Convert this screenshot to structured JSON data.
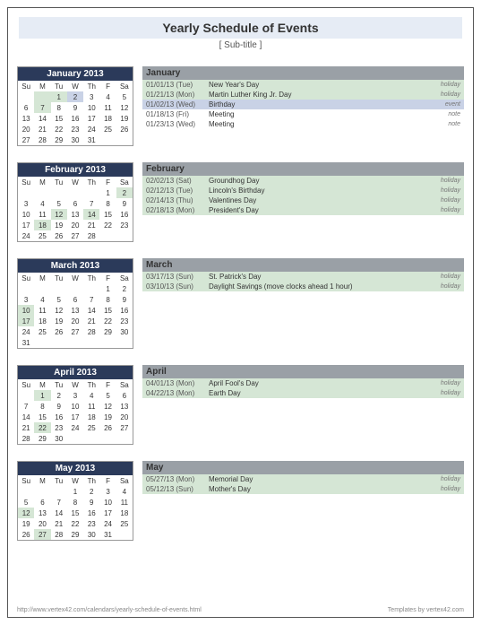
{
  "title": "Yearly Schedule of Events",
  "subtitle": "[ Sub-title ]",
  "dow": [
    "Su",
    "M",
    "Tu",
    "W",
    "Th",
    "F",
    "Sa"
  ],
  "footer_left": "http://www.vertex42.com/calendars/yearly-schedule-of-events.html",
  "footer_right": "Templates by vertex42.com",
  "months": [
    {
      "name": "January 2013",
      "short": "January",
      "weeks": [
        [
          "",
          "",
          "1",
          "2",
          "3",
          "4",
          "5"
        ],
        [
          "6",
          "7",
          "8",
          "9",
          "10",
          "11",
          "12"
        ],
        [
          "13",
          "14",
          "15",
          "16",
          "17",
          "18",
          "19"
        ],
        [
          "20",
          "21",
          "22",
          "23",
          "24",
          "25",
          "26"
        ],
        [
          "27",
          "28",
          "29",
          "30",
          "31",
          "",
          ""
        ]
      ],
      "highlights": {
        "hl": [
          [
            0,
            1
          ],
          [
            0,
            2
          ],
          [
            1,
            1
          ]
        ],
        "hl2": [
          [
            0,
            3
          ]
        ]
      },
      "events": [
        {
          "date": "01/01/13 (Tue)",
          "desc": "New Year's Day",
          "type": "holiday",
          "cls": "holiday"
        },
        {
          "date": "01/21/13 (Mon)",
          "desc": "Martin Luther King Jr. Day",
          "type": "holiday",
          "cls": "holiday"
        },
        {
          "date": "01/02/13 (Wed)",
          "desc": "Birthday",
          "type": "event",
          "cls": "event"
        },
        {
          "date": "01/18/13 (Fri)",
          "desc": "Meeting",
          "type": "note",
          "cls": "note"
        },
        {
          "date": "01/23/13 (Wed)",
          "desc": "Meeting",
          "type": "note",
          "cls": "note"
        }
      ]
    },
    {
      "name": "February 2013",
      "short": "February",
      "weeks": [
        [
          "",
          "",
          "",
          "",
          "",
          "1",
          "2"
        ],
        [
          "3",
          "4",
          "5",
          "6",
          "7",
          "8",
          "9"
        ],
        [
          "10",
          "11",
          "12",
          "13",
          "14",
          "15",
          "16"
        ],
        [
          "17",
          "18",
          "19",
          "20",
          "21",
          "22",
          "23"
        ],
        [
          "24",
          "25",
          "26",
          "27",
          "28",
          "",
          ""
        ]
      ],
      "highlights": {
        "hl": [
          [
            0,
            6
          ],
          [
            2,
            2
          ],
          [
            2,
            4
          ],
          [
            3,
            1
          ]
        ],
        "hl2": []
      },
      "events": [
        {
          "date": "02/02/13 (Sat)",
          "desc": "Groundhog Day",
          "type": "holiday",
          "cls": "holiday"
        },
        {
          "date": "02/12/13 (Tue)",
          "desc": "Lincoln's Birthday",
          "type": "holiday",
          "cls": "holiday"
        },
        {
          "date": "02/14/13 (Thu)",
          "desc": "Valentines Day",
          "type": "holiday",
          "cls": "holiday"
        },
        {
          "date": "02/18/13 (Mon)",
          "desc": "President's Day",
          "type": "holiday",
          "cls": "holiday"
        }
      ]
    },
    {
      "name": "March 2013",
      "short": "March",
      "weeks": [
        [
          "",
          "",
          "",
          "",
          "",
          "1",
          "2"
        ],
        [
          "3",
          "4",
          "5",
          "6",
          "7",
          "8",
          "9"
        ],
        [
          "10",
          "11",
          "12",
          "13",
          "14",
          "15",
          "16"
        ],
        [
          "17",
          "18",
          "19",
          "20",
          "21",
          "22",
          "23"
        ],
        [
          "24",
          "25",
          "26",
          "27",
          "28",
          "29",
          "30"
        ],
        [
          "31",
          "",
          "",
          "",
          "",
          "",
          ""
        ]
      ],
      "highlights": {
        "hl": [
          [
            2,
            0
          ],
          [
            3,
            0
          ]
        ],
        "hl2": []
      },
      "events": [
        {
          "date": "03/17/13 (Sun)",
          "desc": "St. Patrick's Day",
          "type": "holiday",
          "cls": "holiday"
        },
        {
          "date": "03/10/13 (Sun)",
          "desc": "Daylight Savings (move clocks ahead 1 hour)",
          "type": "holiday",
          "cls": "holiday"
        }
      ]
    },
    {
      "name": "April 2013",
      "short": "April",
      "weeks": [
        [
          "",
          "1",
          "2",
          "3",
          "4",
          "5",
          "6"
        ],
        [
          "7",
          "8",
          "9",
          "10",
          "11",
          "12",
          "13"
        ],
        [
          "14",
          "15",
          "16",
          "17",
          "18",
          "19",
          "20"
        ],
        [
          "21",
          "22",
          "23",
          "24",
          "25",
          "26",
          "27"
        ],
        [
          "28",
          "29",
          "30",
          "",
          "",
          "",
          ""
        ]
      ],
      "highlights": {
        "hl": [
          [
            0,
            1
          ],
          [
            3,
            1
          ]
        ],
        "hl2": []
      },
      "events": [
        {
          "date": "04/01/13 (Mon)",
          "desc": "April Fool's Day",
          "type": "holiday",
          "cls": "holiday"
        },
        {
          "date": "04/22/13 (Mon)",
          "desc": "Earth Day",
          "type": "holiday",
          "cls": "holiday"
        }
      ]
    },
    {
      "name": "May 2013",
      "short": "May",
      "weeks": [
        [
          "",
          "",
          "",
          "1",
          "2",
          "3",
          "4"
        ],
        [
          "5",
          "6",
          "7",
          "8",
          "9",
          "10",
          "11"
        ],
        [
          "12",
          "13",
          "14",
          "15",
          "16",
          "17",
          "18"
        ],
        [
          "19",
          "20",
          "21",
          "22",
          "23",
          "24",
          "25"
        ],
        [
          "26",
          "27",
          "28",
          "29",
          "30",
          "31",
          ""
        ]
      ],
      "highlights": {
        "hl": [
          [
            2,
            0
          ],
          [
            4,
            1
          ]
        ],
        "hl2": []
      },
      "events": [
        {
          "date": "05/27/13 (Mon)",
          "desc": "Memorial Day",
          "type": "holiday",
          "cls": "holiday"
        },
        {
          "date": "05/12/13 (Sun)",
          "desc": "Mother's Day",
          "type": "holiday",
          "cls": "holiday"
        }
      ]
    }
  ]
}
